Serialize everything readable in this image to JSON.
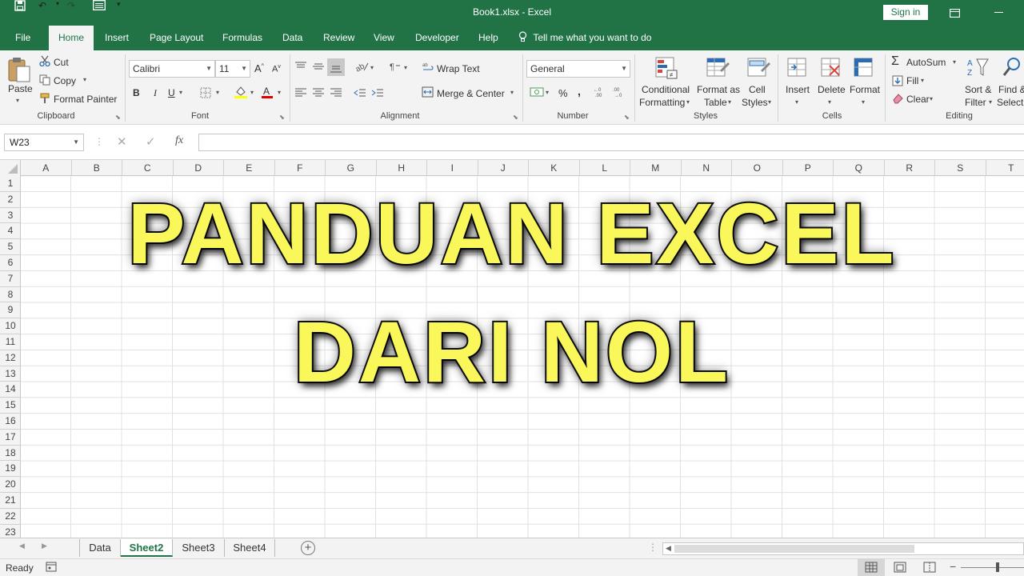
{
  "window": {
    "title": "Book1.xlsx  -  Excel",
    "signin_label": "Sign in"
  },
  "tabs": [
    "File",
    "Home",
    "Insert",
    "Page Layout",
    "Formulas",
    "Data",
    "Review",
    "View",
    "Developer",
    "Help"
  ],
  "tell_me": "Tell me what you want to do",
  "clipboard": {
    "paste": "Paste",
    "cut": "Cut",
    "copy": "Copy",
    "format_painter": "Format Painter",
    "label": "Clipboard"
  },
  "font": {
    "name": "Calibri",
    "size": "11",
    "bold": "B",
    "italic": "I",
    "underline": "U",
    "label": "Font"
  },
  "alignment": {
    "wrap_text": "Wrap Text",
    "merge_center": "Merge & Center",
    "label": "Alignment"
  },
  "number": {
    "format": "General",
    "percent": "%",
    "comma": ",",
    "label": "Number"
  },
  "styles": {
    "conditional_1": "Conditional",
    "conditional_2": "Formatting",
    "format_as_1": "Format as",
    "format_as_2": "Table",
    "cell_1": "Cell",
    "cell_2": "Styles",
    "label": "Styles"
  },
  "cells": {
    "insert": "Insert",
    "delete": "Delete",
    "format": "Format",
    "label": "Cells"
  },
  "editing": {
    "autosum": "AutoSum",
    "fill": "Fill",
    "clear": "Clear",
    "sort_1": "Sort &",
    "sort_2": "Filter",
    "find_1": "Find &",
    "find_2": "Select",
    "label": "Editing"
  },
  "formula_bar": {
    "name_box": "W23",
    "formula": ""
  },
  "columns": [
    "A",
    "B",
    "C",
    "D",
    "E",
    "F",
    "G",
    "H",
    "I",
    "J",
    "K",
    "L",
    "M",
    "N",
    "O",
    "P",
    "Q",
    "R",
    "S",
    "T"
  ],
  "rows": [
    "1",
    "2",
    "3",
    "4",
    "5",
    "6",
    "7",
    "8",
    "9",
    "10",
    "11",
    "12",
    "13",
    "14",
    "15",
    "16",
    "17",
    "18",
    "19",
    "20",
    "21",
    "22",
    "23"
  ],
  "overlay": {
    "line1": "PANDUAN EXCEL",
    "line2": "DARI NOL",
    "color": "#f9f75a"
  },
  "sheets": [
    "Data",
    "Sheet2",
    "Sheet3",
    "Sheet4"
  ],
  "active_sheet": "Sheet2",
  "status": {
    "ready": "Ready"
  },
  "theme": {
    "accent": "#217346"
  }
}
